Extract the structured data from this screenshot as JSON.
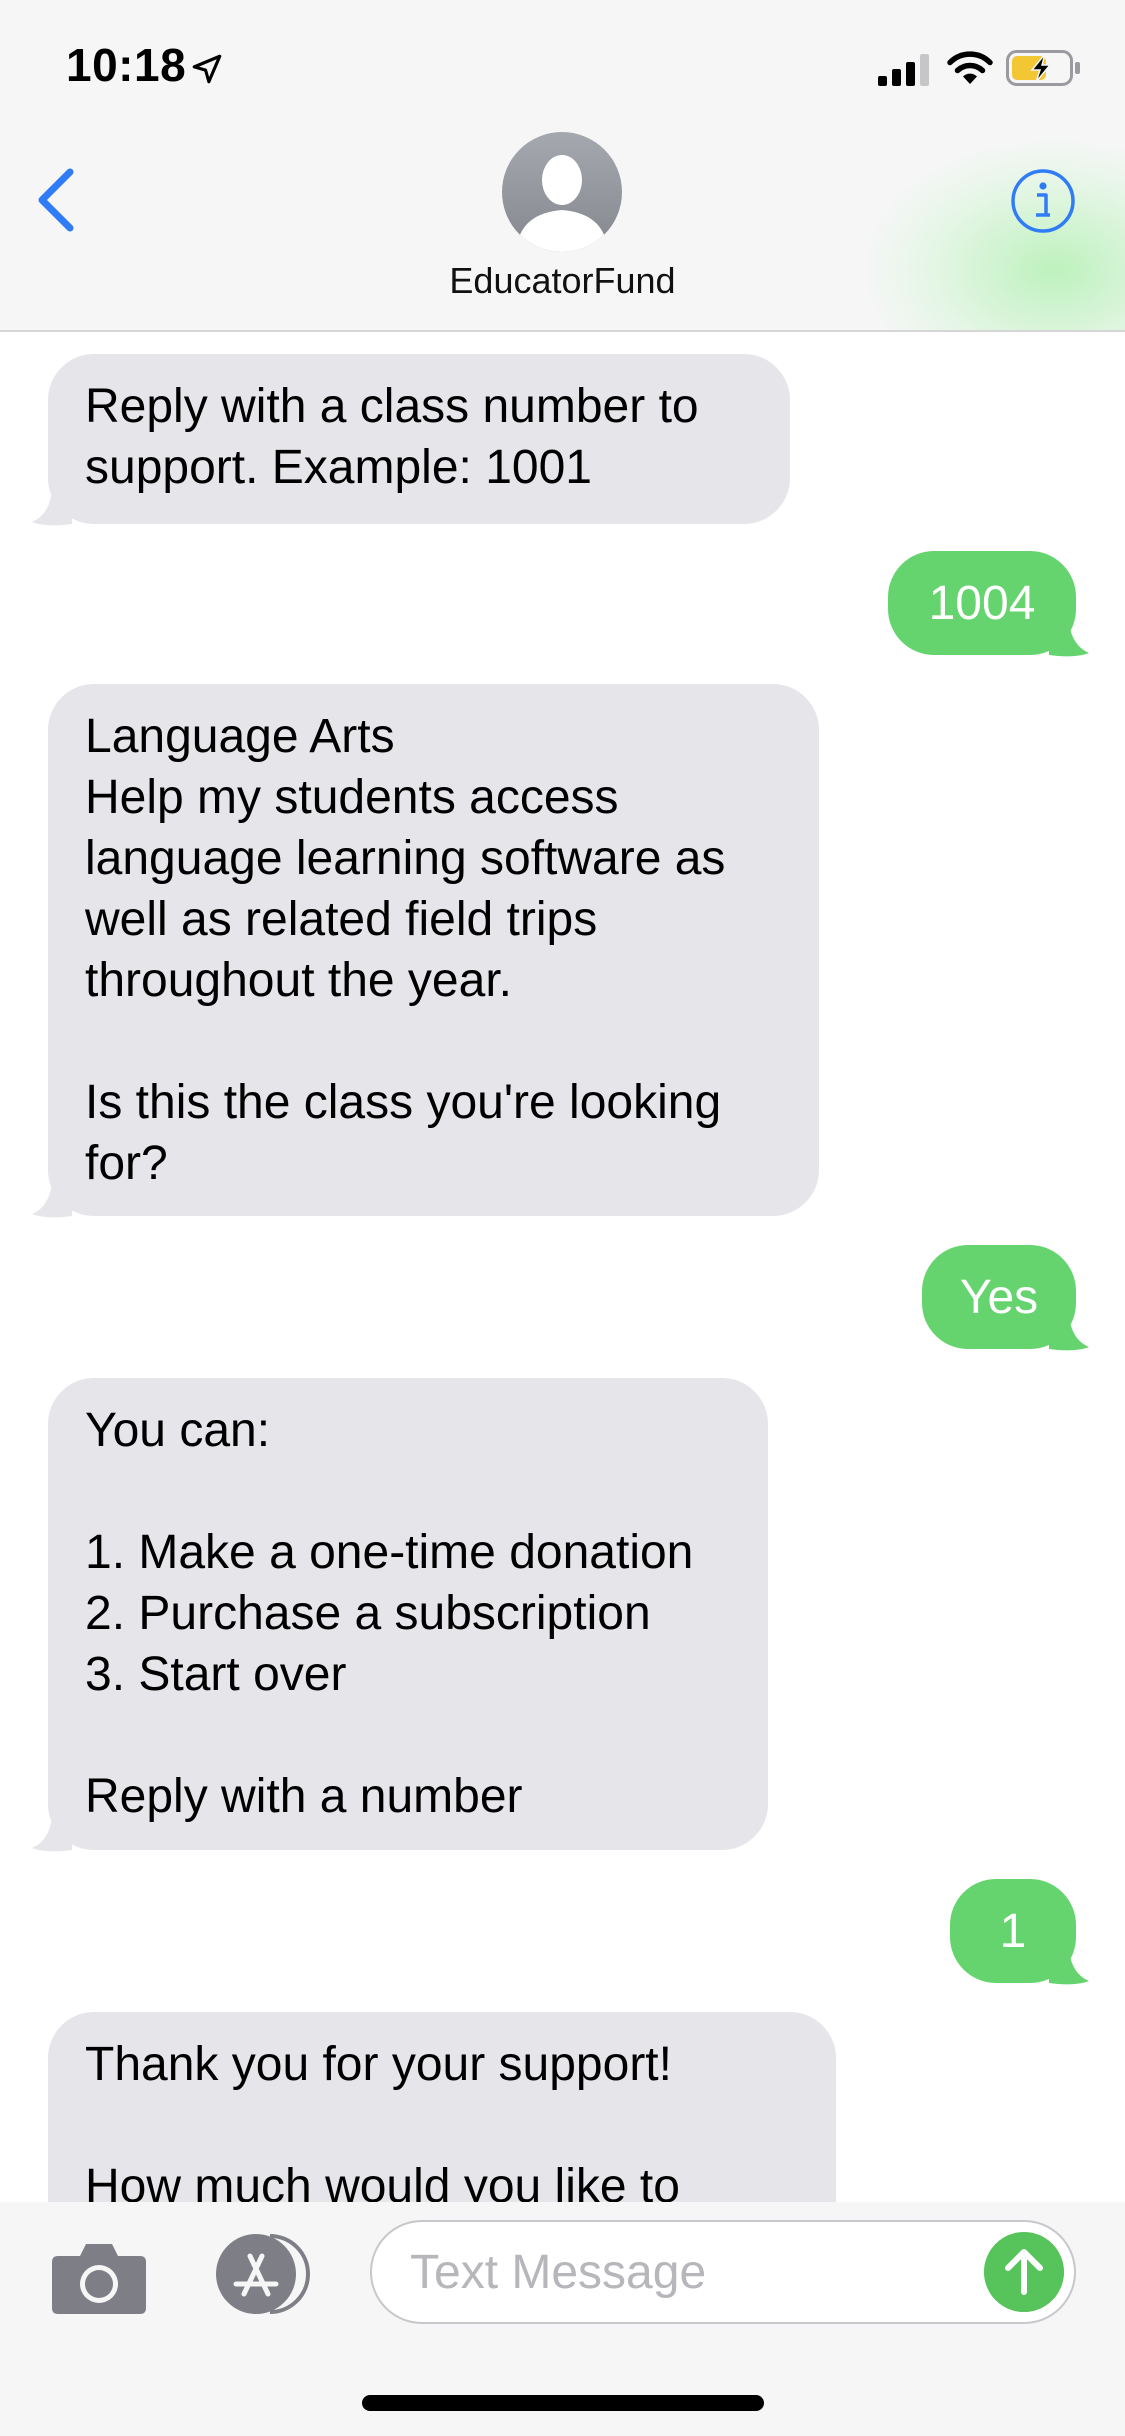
{
  "status_bar": {
    "time": "10:18",
    "icons": [
      "location-arrow-icon",
      "cellular-signal-icon",
      "wifi-icon",
      "battery-charging-icon"
    ]
  },
  "header": {
    "back_icon": "chevron-left-icon",
    "contact_name": "EducatorFund",
    "avatar_icon": "person-silhouette-icon",
    "info_icon": "info-icon"
  },
  "messages": [
    {
      "direction": "received",
      "text": "Reply with a class number to\nsupport.   Example: 1001"
    },
    {
      "direction": "sent",
      "text": "1004"
    },
    {
      "direction": "received",
      "text": "Language Arts\nHelp my students access\nlanguage learning software as\nwell as related field trips\nthroughout the year.\n\nIs this the class you're looking\nfor?"
    },
    {
      "direction": "sent",
      "text": "Yes"
    },
    {
      "direction": "received",
      "text": "You can:\n\n1. Make a one-time donation\n2. Purchase a subscription\n3. Start over\n\nReply with a number"
    },
    {
      "direction": "sent",
      "text": "1"
    },
    {
      "direction": "received",
      "text": "Thank you for your support!\n\nHow much would you like to"
    }
  ],
  "input_bar": {
    "camera_icon": "camera-icon",
    "appstore_icon": "app-store-icon",
    "placeholder": "Text Message",
    "value": "",
    "send_icon": "arrow-up-icon"
  },
  "colors": {
    "sent_bubble": "#65d46e",
    "received_bubble": "#e5e5ea",
    "accent_blue": "#2f7cf6",
    "header_background": "#f6f6f7"
  }
}
